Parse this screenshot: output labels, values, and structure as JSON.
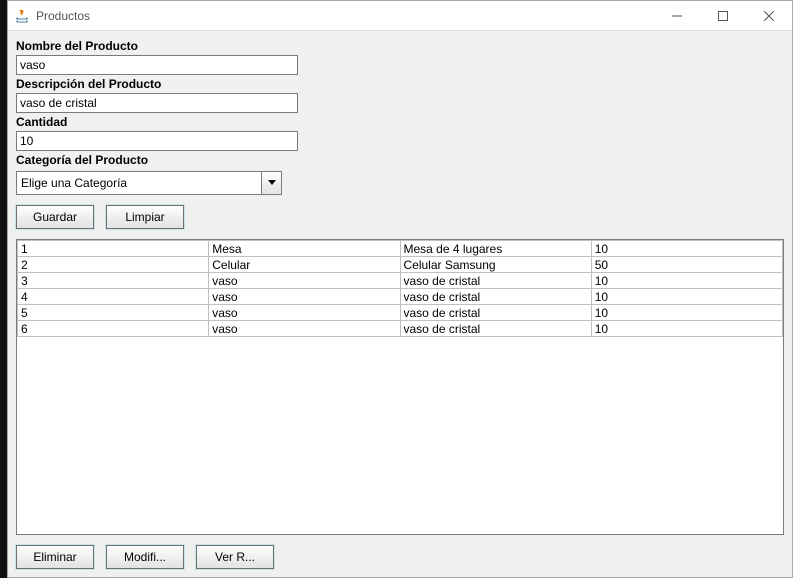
{
  "window": {
    "title": "Productos"
  },
  "fields": {
    "name_label": "Nombre del Producto",
    "name_value": "vaso",
    "desc_label": "Descripción del Producto",
    "desc_value": "vaso de cristal",
    "qty_label": "Cantidad",
    "qty_value": "10",
    "cat_label": "Categoría del Producto",
    "cat_value": "Elige una Categoría"
  },
  "buttons": {
    "save": "Guardar",
    "clear": "Limpiar",
    "delete": "Eliminar",
    "modify": "Modifi...",
    "view": "Ver R..."
  },
  "table": {
    "rows": [
      {
        "c0": "1",
        "c1": "Mesa",
        "c2": "Mesa de 4 lugares",
        "c3": "10"
      },
      {
        "c0": "2",
        "c1": "Celular",
        "c2": "Celular Samsung",
        "c3": "50"
      },
      {
        "c0": "3",
        "c1": "vaso",
        "c2": "vaso de cristal",
        "c3": "10"
      },
      {
        "c0": "4",
        "c1": "vaso",
        "c2": "vaso de cristal",
        "c3": "10"
      },
      {
        "c0": "5",
        "c1": "vaso",
        "c2": "vaso de cristal",
        "c3": "10"
      },
      {
        "c0": "6",
        "c1": "vaso",
        "c2": "vaso de cristal",
        "c3": "10"
      }
    ]
  }
}
